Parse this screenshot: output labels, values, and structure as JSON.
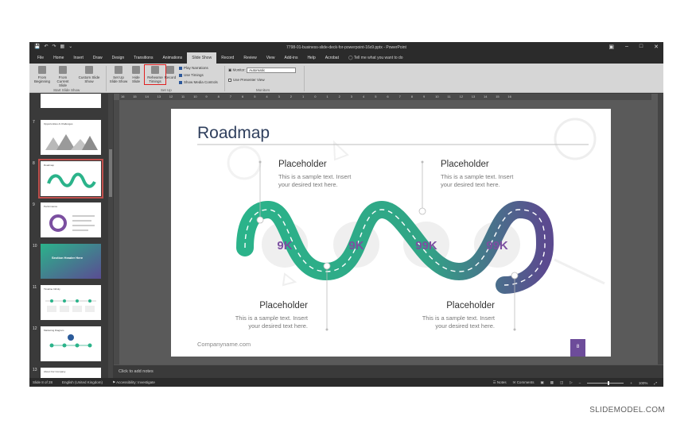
{
  "window": {
    "title": "7798-01-business-slide-deck-for-powerpoint-16x9.pptx - PowerPoint",
    "controls": [
      "▣",
      "–",
      "□",
      "✕"
    ]
  },
  "quick_access": [
    "💾",
    "↶",
    "↷",
    "▦",
    "⌄"
  ],
  "menu": {
    "tabs": [
      "File",
      "Home",
      "Insert",
      "Draw",
      "Design",
      "Transitions",
      "Animations",
      "Slide Show",
      "Record",
      "Review",
      "View",
      "Add-ins",
      "Help",
      "Acrobat"
    ],
    "active_tab": "Slide Show",
    "tell_me": "Tell me what you want to do"
  },
  "ribbon": {
    "from_beginning": "From Beginning",
    "from_current": "From Current Slide",
    "custom_show": "Custom Slide Show",
    "group_start": "Start Slide Show",
    "setup_show": "Set Up Slide Show",
    "hide_slide": "Hide Slide",
    "rehearse": "Rehearse Timings",
    "record": "Record",
    "play_narrations": "Play Narrations",
    "use_timings": "Use Timings",
    "show_media": "Show Media Controls",
    "group_setup": "Set Up",
    "monitor_label": "Monitor:",
    "monitor_value": "Automatic",
    "presenter_view": "Use Presenter View",
    "group_monitors": "Monitors"
  },
  "ruler_ticks": [
    "16",
    "15",
    "14",
    "13",
    "12",
    "11",
    "10",
    "9",
    "8",
    "7",
    "6",
    "5",
    "4",
    "3",
    "2",
    "1",
    "0",
    "1",
    "2",
    "3",
    "4",
    "5",
    "6",
    "7",
    "8",
    "9",
    "10",
    "11",
    "12",
    "13",
    "14",
    "15",
    "16"
  ],
  "thumbnails": [
    {
      "num": "",
      "title": ""
    },
    {
      "num": "7",
      "title": "Opportunities & Challenges"
    },
    {
      "num": "8",
      "title": "Roadmap"
    },
    {
      "num": "9",
      "title": "Performance"
    },
    {
      "num": "10",
      "title": "Section Header Here"
    },
    {
      "num": "11",
      "title": "Timeline Infinity"
    },
    {
      "num": "12",
      "title": "Marketing Diagram"
    },
    {
      "num": "13",
      "title": "About Our Company"
    }
  ],
  "slide": {
    "title": "Roadmap",
    "company": "Companyname.com",
    "page_number": "8",
    "placeholders": [
      {
        "heading": "Placeholder",
        "line1": "This is a sample text. Insert",
        "line2": "your desired text here."
      },
      {
        "heading": "Placeholder",
        "line1": "This is a sample text. Insert",
        "line2": "your desired text here."
      },
      {
        "heading": "Placeholder",
        "line1": "This is a sample text. Insert",
        "line2": "your desired text here."
      },
      {
        "heading": "Placeholder",
        "line1": "This is a sample text. Insert",
        "line2": "your desired text here."
      }
    ],
    "values": [
      "9K",
      "9K",
      "99K",
      "99K"
    ],
    "colors": {
      "title": "#2e3e5c",
      "value": "#7b4fa0",
      "road_start": "#2bb38a",
      "road_end": "#6a4c93",
      "accent": "#6d4c9a"
    }
  },
  "notes_placeholder": "Click to add notes",
  "status": {
    "slide_info": "Slide 8 of 28",
    "language": "English (United Kingdom)",
    "accessibility": "Accessibility: Investigate",
    "notes": "Notes",
    "comments": "Comments",
    "zoom": "100%"
  },
  "watermark": "SLIDEMODEL.COM"
}
